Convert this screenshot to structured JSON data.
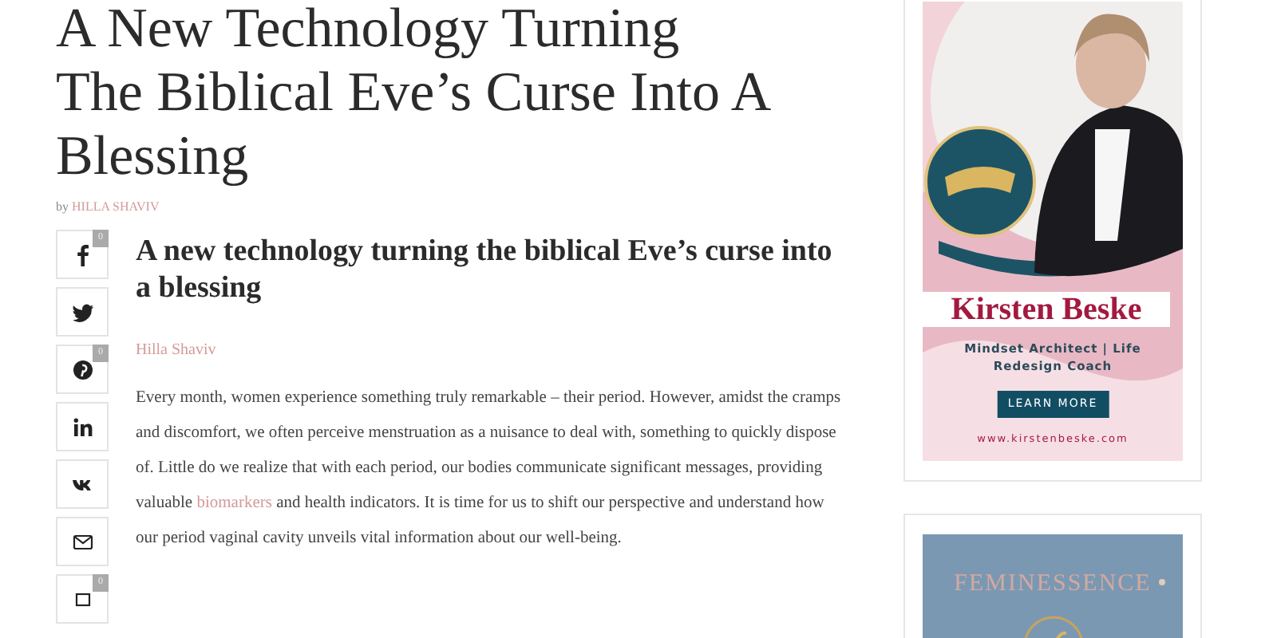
{
  "article": {
    "title_lines": [
      "A New Technology Turning",
      "The Biblical Eve’s Curse Into A",
      "Blessing"
    ],
    "byline_prefix": "by",
    "byline_author": "HILLA SHAVIV",
    "subtitle": "A new technology turning the biblical Eve’s curse into a blessing",
    "author": "Hilla Shaviv",
    "body": [
      {
        "text": "Every month, women experience something truly remarkable – their period. However, amidst the cramps and discomfort, we often perceive menstruation as a nuisance to deal with, something to quickly dispose of. Little do we realize that with each period, our bodies communicate significant messages, providing valuable "
      },
      {
        "link": "biomarkers"
      },
      {
        "text": " and health indicators. It is time for us to shift our perspective and understand how our period vaginal cavity unveils vital information about our well-being."
      }
    ]
  },
  "share_buttons": [
    {
      "kind": "facebook",
      "count": "0"
    },
    {
      "kind": "twitter"
    },
    {
      "kind": "pinterest",
      "count": "0"
    },
    {
      "kind": "linkedin"
    },
    {
      "kind": "vk"
    },
    {
      "kind": "email"
    },
    {
      "kind": "bookmark",
      "count": "0"
    }
  ],
  "sidebar": {
    "ads": [
      {
        "kind": "profile",
        "name": "Kirsten Beske",
        "tagline": "Mindset Architect | Life Redesign Coach",
        "button": "LEARN MORE",
        "url": "www.kirstenbeske.com"
      },
      {
        "kind": "brand",
        "name": "FEMINESSENCE"
      }
    ]
  }
}
